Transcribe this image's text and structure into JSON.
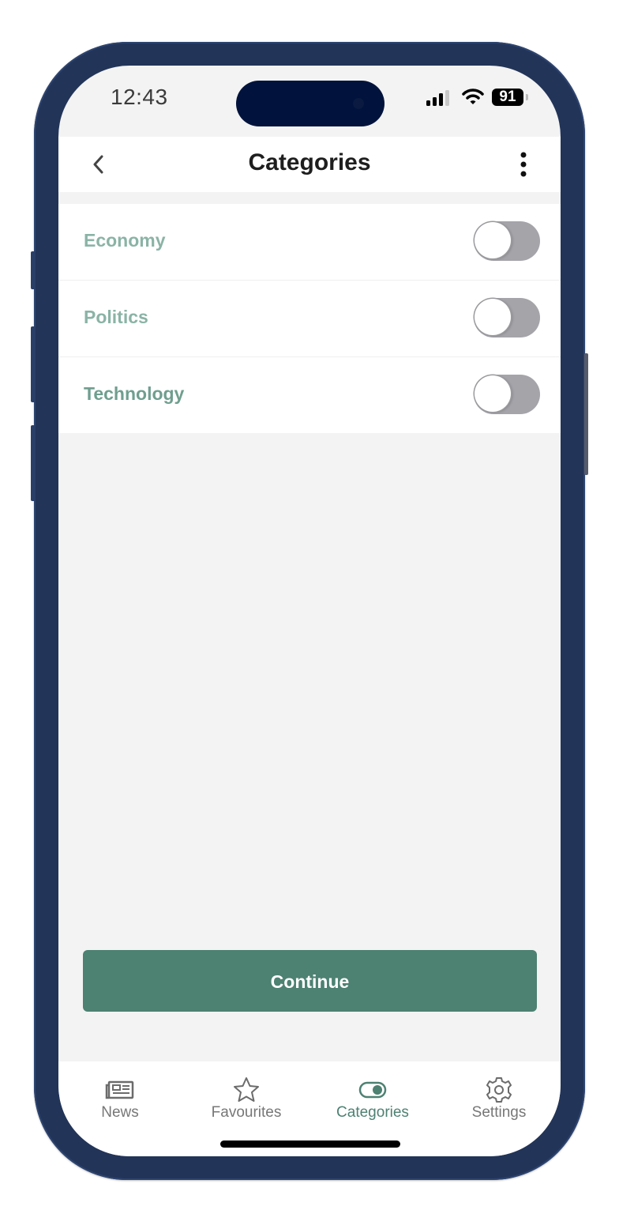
{
  "status_bar": {
    "time": "12:43",
    "battery_percent": "91",
    "signal_icon": "cellular-signal-icon",
    "wifi_icon": "wifi-icon"
  },
  "header": {
    "title": "Categories",
    "back_icon": "chevron-left-icon",
    "more_icon": "more-vertical-icon"
  },
  "categories": [
    {
      "label": "Economy",
      "enabled": false
    },
    {
      "label": "Politics",
      "enabled": false
    },
    {
      "label": "Technology",
      "enabled": false
    }
  ],
  "continue_button": {
    "label": "Continue"
  },
  "tab_bar": {
    "items": [
      {
        "label": "News",
        "icon": "newspaper-icon",
        "active": false
      },
      {
        "label": "Favourites",
        "icon": "star-icon",
        "active": false
      },
      {
        "label": "Categories",
        "icon": "toggle-icon",
        "active": true
      },
      {
        "label": "Settings",
        "icon": "gear-icon",
        "active": false
      }
    ]
  },
  "colors": {
    "accent": "#4d8172",
    "label_green": "#8ab3a6",
    "toggle_off": "#a4a4a9",
    "frame": "#223458",
    "island": "#01133c"
  }
}
